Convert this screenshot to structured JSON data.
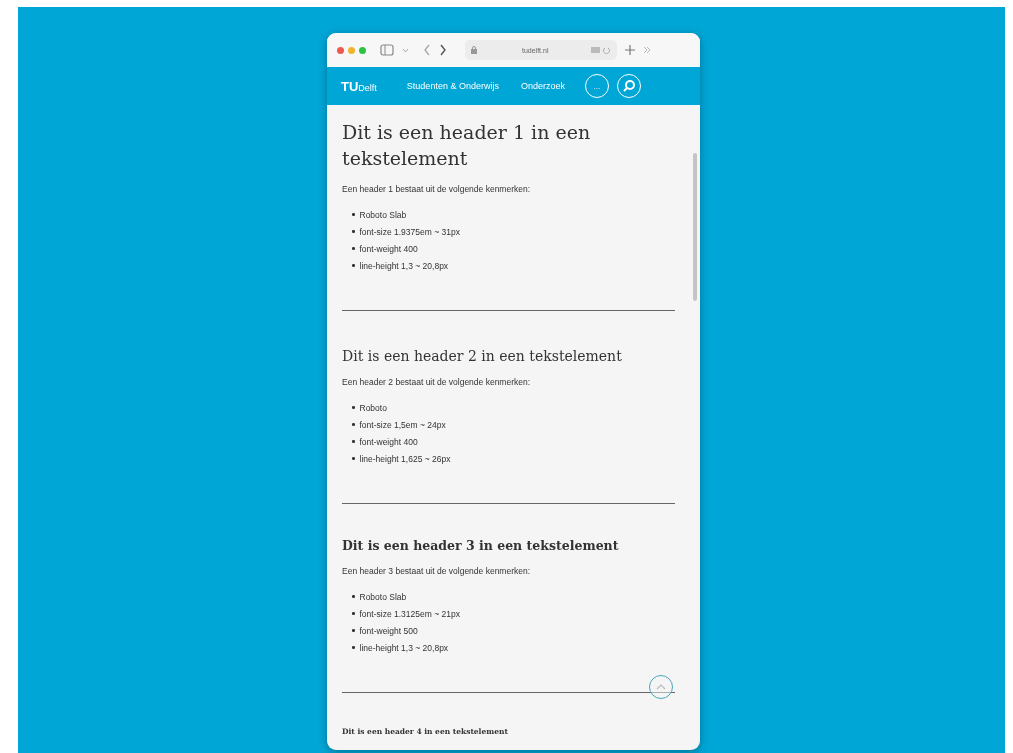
{
  "browser": {
    "url": "tudelft.nl"
  },
  "nav": {
    "logo": {
      "mark": "TU",
      "name": "Delft"
    },
    "links": [
      "Studenten & Onderwijs",
      "Onderzoek"
    ],
    "more": "..."
  },
  "sections": [
    {
      "kind": "h1",
      "heading": "Dit is een header 1 in een tekstelement",
      "intro": "Een header 1 bestaat uit de volgende kenmerken:",
      "bullets": [
        "Roboto Slab",
        "font-size 1.9375em ~ 31px",
        "font-weight 400",
        "line-height 1,3 ~ 20,8px"
      ]
    },
    {
      "kind": "h2",
      "heading": "Dit is een header 2 in een tekstelement",
      "intro": "Een header 2 bestaat uit de volgende kenmerken:",
      "bullets": [
        "Roboto",
        "font-size 1,5em ~ 24px",
        "font-weight 400",
        "line-height 1,625 ~ 26px"
      ]
    },
    {
      "kind": "h3",
      "heading": "Dit is een header 3 in een tekstelement",
      "intro": "Een header 3 bestaat uit de volgende kenmerken:",
      "bullets": [
        "Roboto Slab",
        "font-size 1.3125em ~ 21px",
        "font-weight 500",
        "line-height 1,3 ~ 20,8px"
      ]
    },
    {
      "kind": "h4",
      "heading": "Dit is een header 4 in een tekstelement"
    }
  ]
}
